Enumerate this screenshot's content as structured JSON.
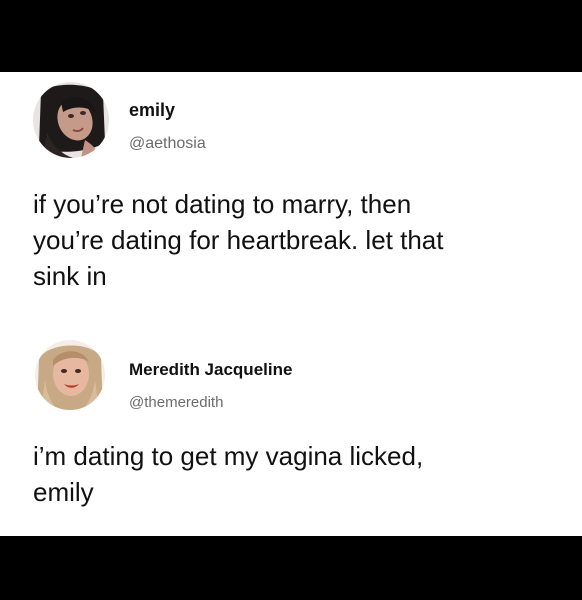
{
  "tweets": [
    {
      "name": "emily",
      "handle": "@aethosia",
      "text_line1": "if you’re not dating to marry, then",
      "text_line2": "you’re dating for heartbreak. let that",
      "text_line3": "sink in"
    },
    {
      "name": "Meredith Jacqueline",
      "handle": "@themeredith",
      "text_line1": "i’m dating to get my vagina licked,",
      "text_line2": "emily"
    }
  ]
}
